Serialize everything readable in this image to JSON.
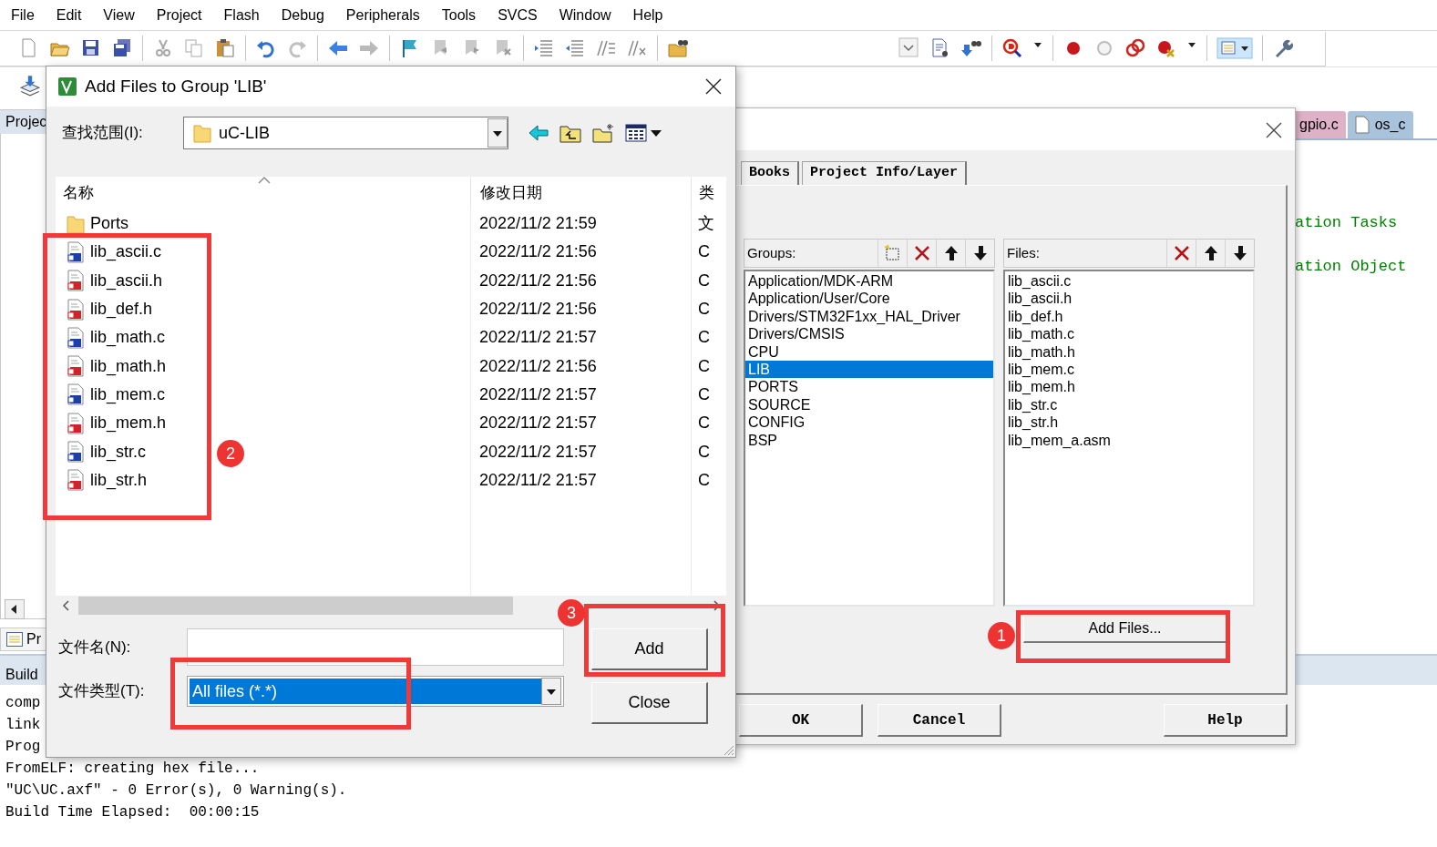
{
  "menu": [
    "File",
    "Edit",
    "View",
    "Project",
    "Flash",
    "Debug",
    "Peripherals",
    "Tools",
    "SVCS",
    "Window",
    "Help"
  ],
  "ide": {
    "project_tab": "Projec",
    "project_bottom_tab": "Pr",
    "build_tab": "Build",
    "build_output": [
      "comp",
      "link",
      "Prog",
      "FromELF: creating hex file...",
      "\"UC\\UC.axf\" - 0 Error(s), 0 Warning(s).",
      "Build Time Elapsed:  00:00:15"
    ],
    "editor_tabs": [
      {
        "label": "gpio.c",
        "color": "#dfb1c6"
      },
      {
        "label": "os_c",
        "color": "#a9c3dd"
      }
    ],
    "editor_lines": [
      "ation Tasks",
      "ation Object"
    ]
  },
  "manage_dialog": {
    "tabs": [
      "Books",
      "Project Info/Layer"
    ],
    "groups_label": "Groups:",
    "groups": [
      {
        "label": "Application/MDK-ARM",
        "selected": false
      },
      {
        "label": "Application/User/Core",
        "selected": false
      },
      {
        "label": "Drivers/STM32F1xx_HAL_Driver",
        "selected": false
      },
      {
        "label": "Drivers/CMSIS",
        "selected": false
      },
      {
        "label": "CPU",
        "selected": false
      },
      {
        "label": "LIB",
        "selected": true
      },
      {
        "label": "PORTS",
        "selected": false
      },
      {
        "label": "SOURCE",
        "selected": false
      },
      {
        "label": "CONFIG",
        "selected": false
      },
      {
        "label": "BSP",
        "selected": false
      }
    ],
    "files_label": "Files:",
    "files": [
      "lib_ascii.c",
      "lib_ascii.h",
      "lib_def.h",
      "lib_math.c",
      "lib_math.h",
      "lib_mem.c",
      "lib_mem.h",
      "lib_str.c",
      "lib_str.h",
      "lib_mem_a.asm"
    ],
    "add_files_button": "Add Files...",
    "buttons": [
      "OK",
      "Cancel",
      "Help"
    ]
  },
  "add_dialog": {
    "title": "Add Files to Group 'LIB'",
    "look_in_label": "查找范围(I):",
    "look_in": "uC-LIB",
    "columns": [
      "名称",
      "修改日期",
      "类"
    ],
    "rows": [
      {
        "kind": "folder",
        "name": "Ports",
        "date": "2022/11/2 21:59",
        "type": "文"
      },
      {
        "kind": "c-file",
        "name": "lib_ascii.c",
        "date": "2022/11/2 21:56",
        "type": "C"
      },
      {
        "kind": "h-file",
        "name": "lib_ascii.h",
        "date": "2022/11/2 21:56",
        "type": "C"
      },
      {
        "kind": "h-file",
        "name": "lib_def.h",
        "date": "2022/11/2 21:56",
        "type": "C"
      },
      {
        "kind": "c-file",
        "name": "lib_math.c",
        "date": "2022/11/2 21:57",
        "type": "C"
      },
      {
        "kind": "h-file",
        "name": "lib_math.h",
        "date": "2022/11/2 21:56",
        "type": "C"
      },
      {
        "kind": "c-file",
        "name": "lib_mem.c",
        "date": "2022/11/2 21:57",
        "type": "C"
      },
      {
        "kind": "h-file",
        "name": "lib_mem.h",
        "date": "2022/11/2 21:57",
        "type": "C"
      },
      {
        "kind": "c-file",
        "name": "lib_str.c",
        "date": "2022/11/2 21:57",
        "type": "C"
      },
      {
        "kind": "h-file",
        "name": "lib_str.h",
        "date": "2022/11/2 21:57",
        "type": "C"
      }
    ],
    "file_name_label": "文件名(N):",
    "file_type_label": "文件类型(T):",
    "file_type": "All files (*.*)",
    "buttons": [
      "Add",
      "Close"
    ]
  },
  "annotations": [
    {
      "number": "1"
    },
    {
      "number": "2"
    },
    {
      "number": "3"
    }
  ]
}
